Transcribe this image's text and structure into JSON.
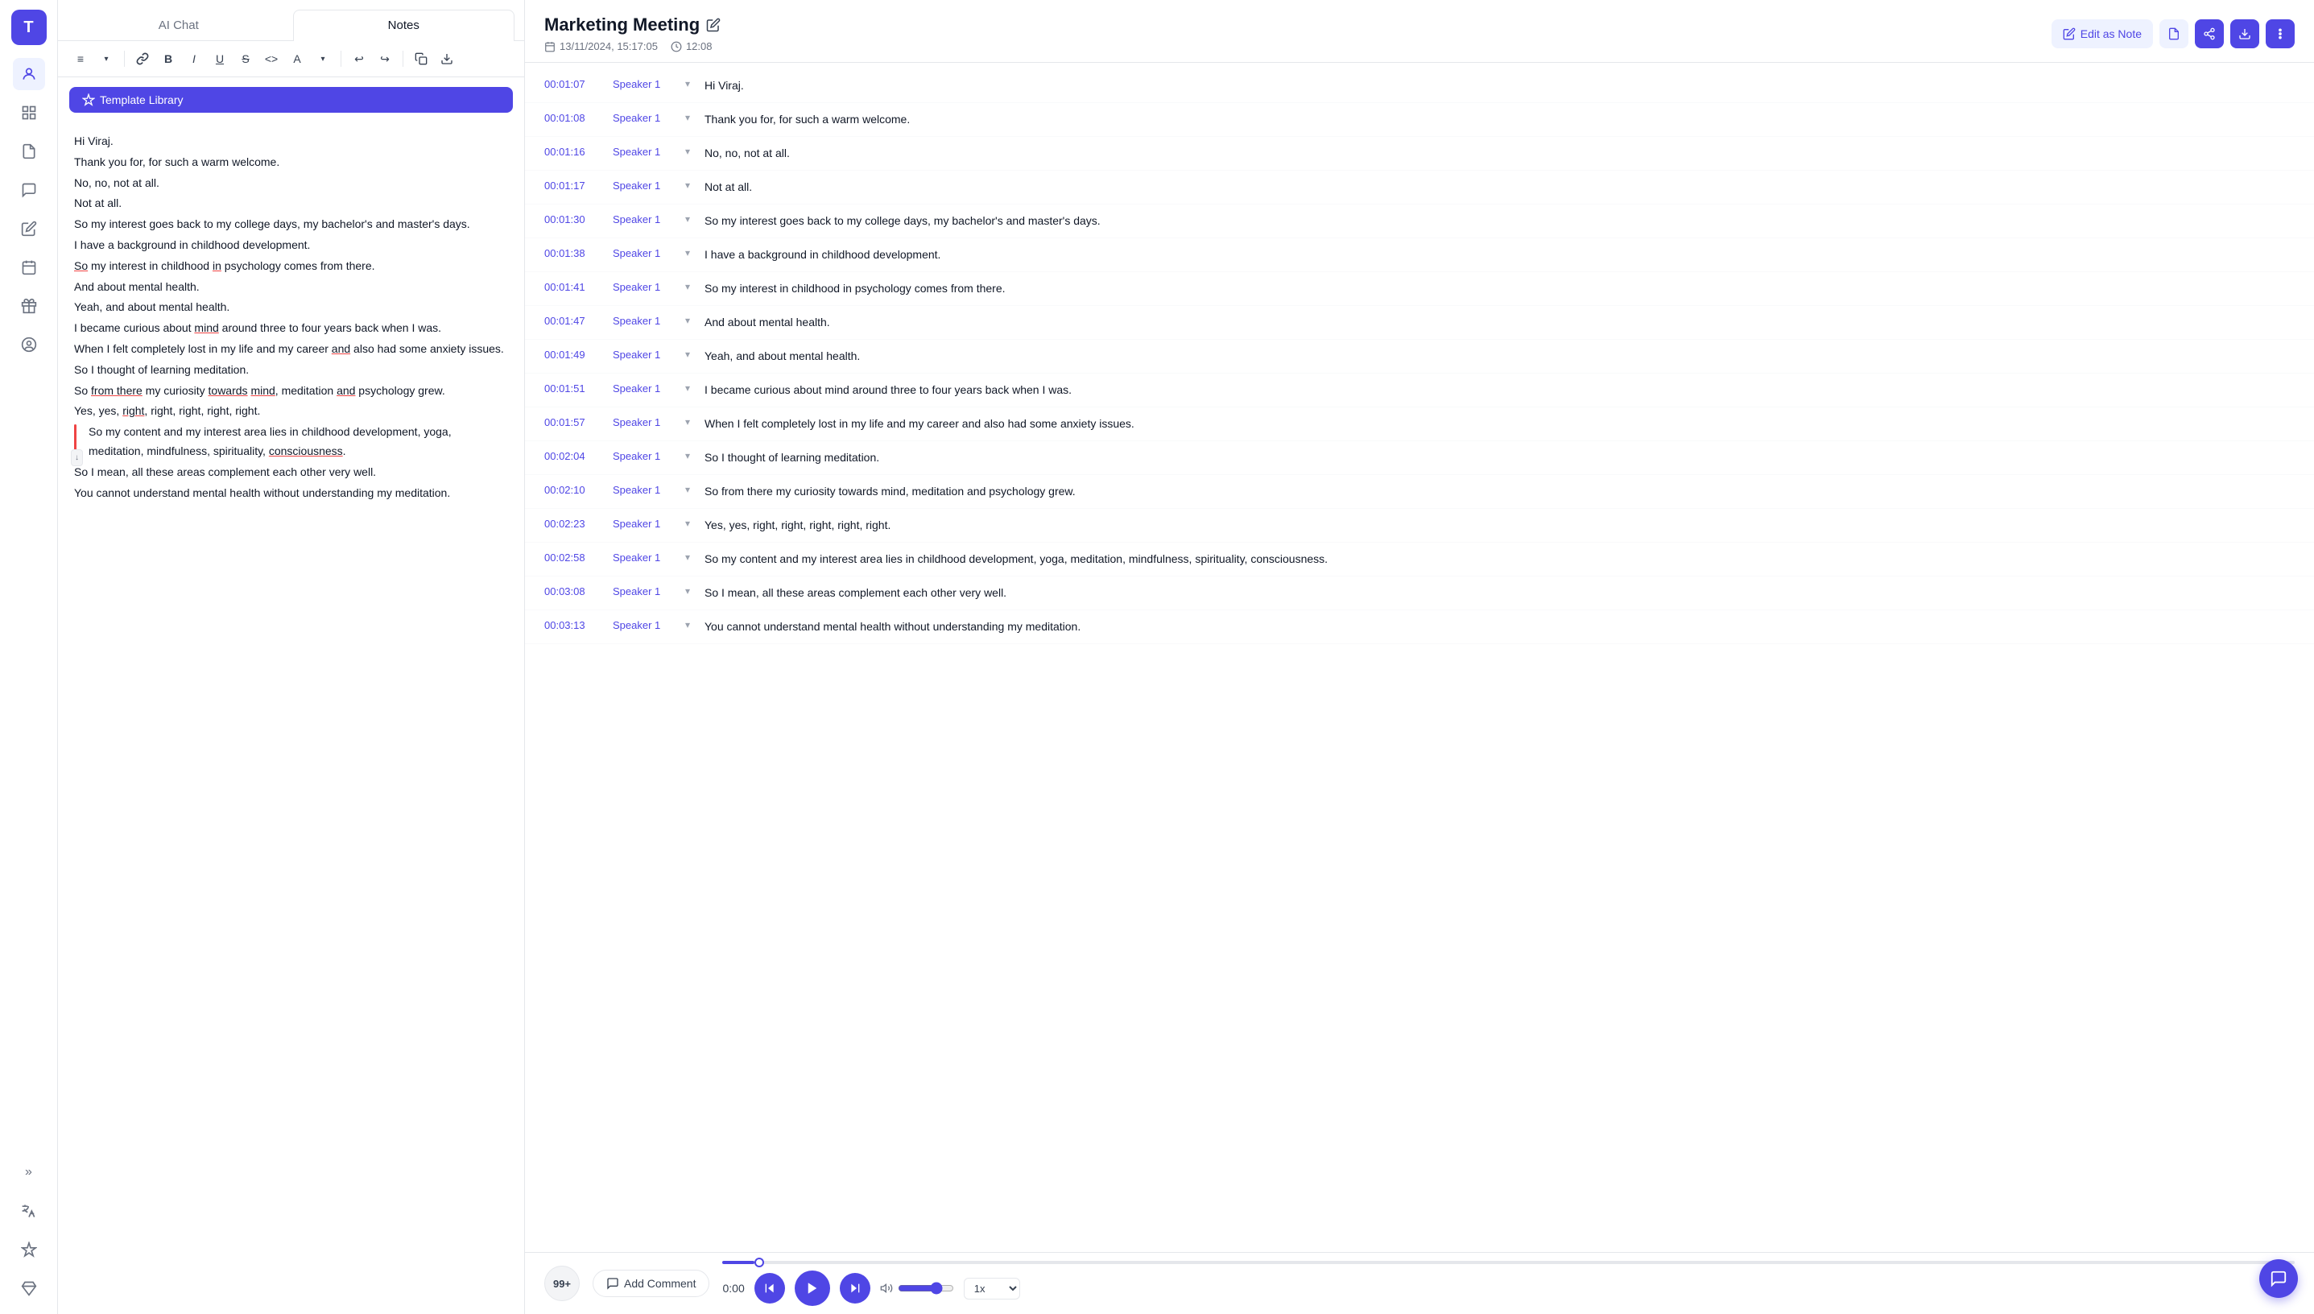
{
  "app": {
    "logo": "T"
  },
  "sidebar": {
    "icons": [
      {
        "name": "users-icon",
        "symbol": "👤",
        "active": true
      },
      {
        "name": "grid-icon",
        "symbol": "⊞",
        "active": false
      },
      {
        "name": "document-icon",
        "symbol": "📄",
        "active": false
      },
      {
        "name": "chat-icon",
        "symbol": "💬",
        "active": false
      },
      {
        "name": "edit-icon",
        "symbol": "✏️",
        "active": false
      },
      {
        "name": "calendar-icon",
        "symbol": "📅",
        "active": false
      },
      {
        "name": "gift-icon",
        "symbol": "🎁",
        "active": false
      },
      {
        "name": "person-icon",
        "symbol": "👤",
        "active": false
      },
      {
        "name": "translate-icon",
        "symbol": "🌐",
        "active": false
      },
      {
        "name": "sparkle-icon",
        "symbol": "✨",
        "active": false
      },
      {
        "name": "diamond-icon",
        "symbol": "💎",
        "active": false
      }
    ],
    "expand_icon": "»"
  },
  "left_panel": {
    "tabs": [
      {
        "label": "AI Chat",
        "active": false
      },
      {
        "label": "Notes",
        "active": true
      }
    ],
    "toolbar": {
      "buttons": [
        "≡",
        "↓",
        "🔗",
        "B",
        "I",
        "U",
        "S",
        "<>",
        "A",
        "↓",
        "↩",
        "↪",
        "⎘",
        "⬇"
      ]
    },
    "template_button": "Template Library",
    "content_lines": [
      "Hi Viraj.",
      "Thank you for, for such a warm welcome.",
      "No, no, not at all.",
      "Not at all.",
      "So my interest goes back to my college days, my bachelor's and master's days.",
      "I have a background in childhood development.",
      "So my interest in childhood in psychology comes from there.",
      "And about mental health.",
      "Yeah, and about mental health.",
      "I became curious about mind around three to four years back when I was.",
      "When I felt completely lost in my life and my career and also had some anxiety issues.",
      "So I thought of learning meditation.",
      "So from there my curiosity towards mind, meditation and psychology grew.",
      "Yes, yes, right, right, right, right, right.",
      "So my content and my interest area lies in childhood development, yoga, meditation, mindfulness, spirituality, consciousness.",
      "So I mean, all these areas complement each other very well.",
      "You cannot understand mental health without understanding my meditation."
    ]
  },
  "right_panel": {
    "title": "Marketing Meeting",
    "meta": {
      "date": "13/11/2024, 15:17:05",
      "duration": "12:08"
    },
    "actions": {
      "edit_note": "Edit as Note",
      "icons": [
        "doc-icon",
        "share-icon",
        "download-icon",
        "more-icon"
      ]
    },
    "transcript": [
      {
        "time": "00:01:07",
        "speaker": "Speaker 1",
        "text": "Hi Viraj."
      },
      {
        "time": "00:01:08",
        "speaker": "Speaker 1",
        "text": "Thank you for, for such a warm welcome."
      },
      {
        "time": "00:01:16",
        "speaker": "Speaker 1",
        "text": "No, no, not at all."
      },
      {
        "time": "00:01:17",
        "speaker": "Speaker 1",
        "text": "Not at all."
      },
      {
        "time": "00:01:30",
        "speaker": "Speaker 1",
        "text": "So my interest goes back to my college days, my bachelor's and master's days."
      },
      {
        "time": "00:01:38",
        "speaker": "Speaker 1",
        "text": "I have a background in childhood development."
      },
      {
        "time": "00:01:41",
        "speaker": "Speaker 1",
        "text": "So my interest in childhood in psychology comes from there."
      },
      {
        "time": "00:01:47",
        "speaker": "Speaker 1",
        "text": "And about mental health."
      },
      {
        "time": "00:01:49",
        "speaker": "Speaker 1",
        "text": "Yeah, and about mental health."
      },
      {
        "time": "00:01:51",
        "speaker": "Speaker 1",
        "text": "I became curious about mind around three to four years back when I was."
      },
      {
        "time": "00:01:57",
        "speaker": "Speaker 1",
        "text": "When I felt completely lost in my life and my career and also had some anxiety issues."
      },
      {
        "time": "00:02:04",
        "speaker": "Speaker 1",
        "text": "So I thought of learning meditation."
      },
      {
        "time": "00:02:10",
        "speaker": "Speaker 1",
        "text": "So from there my curiosity towards mind, meditation and psychology grew."
      },
      {
        "time": "00:02:23",
        "speaker": "Speaker 1",
        "text": "Yes, yes, right, right, right, right, right."
      },
      {
        "time": "00:02:58",
        "speaker": "Speaker 1",
        "text": "So my content and my interest area lies in childhood development, yoga, meditation, mindfulness, spirituality, consciousness."
      },
      {
        "time": "00:03:08",
        "speaker": "Speaker 1",
        "text": "So I mean, all these areas complement each other very well."
      },
      {
        "time": "00:03:13",
        "speaker": "Speaker 1",
        "text": "You cannot understand mental health without understanding my meditation."
      }
    ],
    "player": {
      "badge": "99+",
      "add_comment": "Add Comment",
      "time_current": "0:00",
      "speed": "1x",
      "progress_percent": 2
    }
  }
}
